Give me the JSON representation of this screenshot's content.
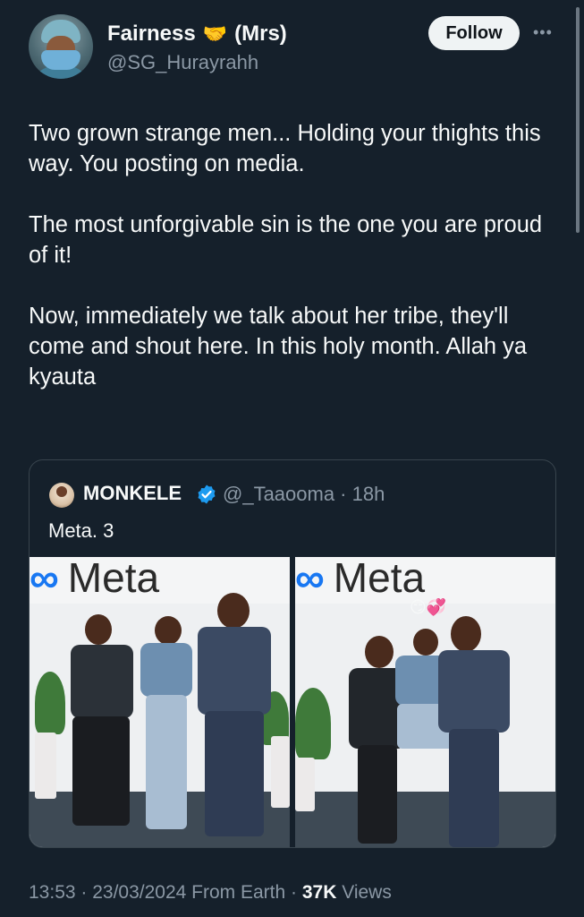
{
  "author": {
    "display_name": "Fairness",
    "badge": "(Mrs)",
    "handle": "@SG_Hurayrahh",
    "follow_label": "Follow",
    "more_icon": "more-dots-icon"
  },
  "tweet": {
    "paragraphs": [
      "Two grown strange men... Holding your thights this way. You posting on media.",
      "The most unforgivable sin is the one you are proud of it!",
      "Now, immediately we talk about her tribe, they'll come and shout here. In this holy month. Allah ya kyauta"
    ]
  },
  "quote": {
    "name": "MONKELE",
    "handle_time": "@_Taaooma · 18h",
    "text": "Meta. 3",
    "banner_text": "Meta",
    "verified_color": "#1d9bf0"
  },
  "footer": {
    "time_date": "13:53 · 23/03/2024 From Earth · ",
    "views_count": "37K",
    "views_label": " Views"
  },
  "colors": {
    "background": "#15202b",
    "secondary_text": "#8b98a5",
    "border": "#38444d"
  }
}
